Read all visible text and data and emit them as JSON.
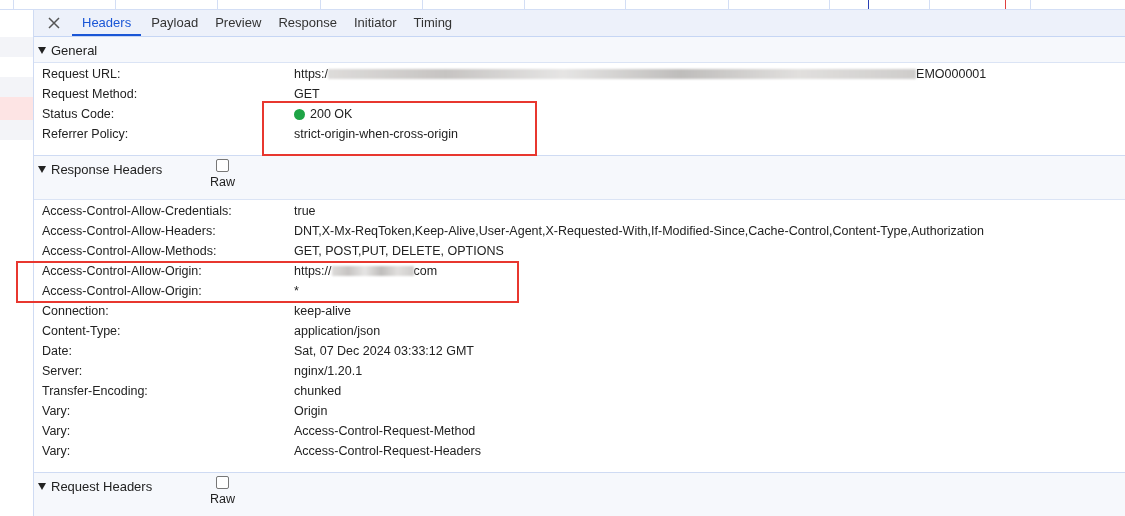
{
  "request_list": [
    {
      "error": false
    },
    {
      "error": false
    },
    {
      "error": false
    },
    {
      "error": true
    },
    {
      "error": false
    }
  ],
  "tabs": [
    {
      "label": "Headers",
      "selected": true
    },
    {
      "label": "Payload",
      "selected": false
    },
    {
      "label": "Preview",
      "selected": false
    },
    {
      "label": "Response",
      "selected": false
    },
    {
      "label": "Initiator",
      "selected": false
    },
    {
      "label": "Timing",
      "selected": false
    }
  ],
  "sections": [
    {
      "title": "General",
      "expanded": true,
      "rows": [
        {
          "key": "Request URL:",
          "kind": "redacted",
          "value": "https:/",
          "value_end": "EMO000001",
          "redaction": {
            "kind": "long"
          }
        },
        {
          "key": "Request Method:",
          "kind": "text",
          "value": "GET"
        },
        {
          "key": "Status Code:",
          "kind": "status",
          "value": "200 OK",
          "color": "#1ea446",
          "highlight": {
            "kind": "value"
          }
        },
        {
          "key": "Referrer Policy:",
          "kind": "text",
          "value": "strict-origin-when-cross-origin",
          "highlight": {
            "kind": "value"
          }
        }
      ]
    },
    {
      "title": "Response Headers",
      "expanded": true,
      "raw": {
        "label": "Raw",
        "checked": false
      },
      "rows": [
        {
          "key": "Access-Control-Allow-Credentials:",
          "kind": "text",
          "value": "true"
        },
        {
          "key": "Access-Control-Allow-Headers:",
          "kind": "text",
          "value": "DNT,X-Mx-ReqToken,Keep-Alive,User-Agent,X-Requested-With,If-Modified-Since,Cache-Control,Content-Type,Authorization"
        },
        {
          "key": "Access-Control-Allow-Methods:",
          "kind": "text",
          "value": "GET, POST,PUT, DELETE, OPTIONS"
        },
        {
          "key": "Access-Control-Allow-Origin:",
          "kind": "redacted",
          "value": "https://",
          "value_end": "com",
          "redaction": {
            "kind": "short"
          },
          "highlight": {
            "kind": "row"
          }
        },
        {
          "key": "Access-Control-Allow-Origin:",
          "kind": "text",
          "value": "*",
          "highlight": {
            "kind": "row"
          }
        },
        {
          "key": "Connection:",
          "kind": "text",
          "value": "keep-alive"
        },
        {
          "key": "Content-Type:",
          "kind": "text",
          "value": "application/json"
        },
        {
          "key": "Date:",
          "kind": "text",
          "value": "Sat, 07 Dec 2024 03:33:12 GMT"
        },
        {
          "key": "Server:",
          "kind": "text",
          "value": "nginx/1.20.1"
        },
        {
          "key": "Transfer-Encoding:",
          "kind": "text",
          "value": "chunked"
        },
        {
          "key": "Vary:",
          "kind": "text",
          "value": "Origin"
        },
        {
          "key": "Vary:",
          "kind": "text",
          "value": "Access-Control-Request-Method"
        },
        {
          "key": "Vary:",
          "kind": "text",
          "value": "Access-Control-Request-Headers"
        }
      ]
    },
    {
      "title": "Request Headers",
      "expanded": true,
      "raw": {
        "label": "Raw",
        "checked": false
      }
    }
  ]
}
